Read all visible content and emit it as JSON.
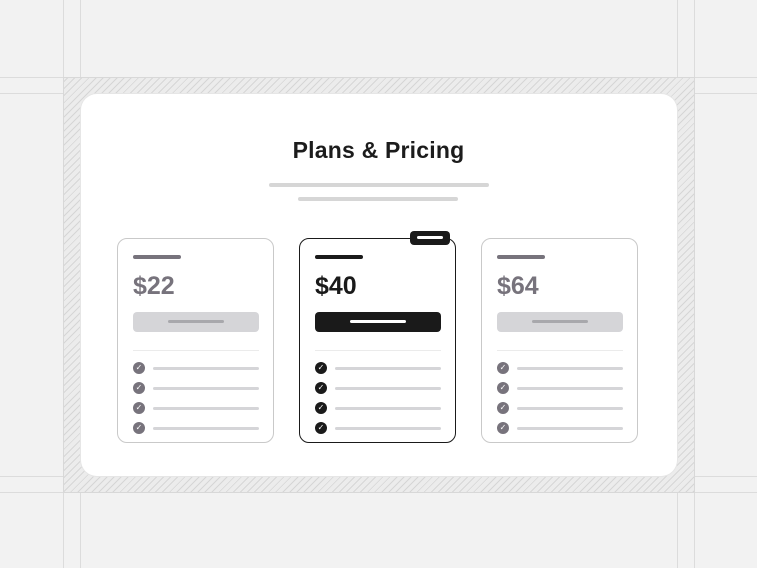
{
  "header": {
    "title": "Plans & Pricing"
  },
  "plans": [
    {
      "price": "$22",
      "featured": false
    },
    {
      "price": "$40",
      "featured": true
    },
    {
      "price": "$64",
      "featured": false
    }
  ],
  "colors": {
    "accent": "#1a1a1a",
    "muted": "#77737c",
    "placeholder": "#d5d5d8"
  }
}
